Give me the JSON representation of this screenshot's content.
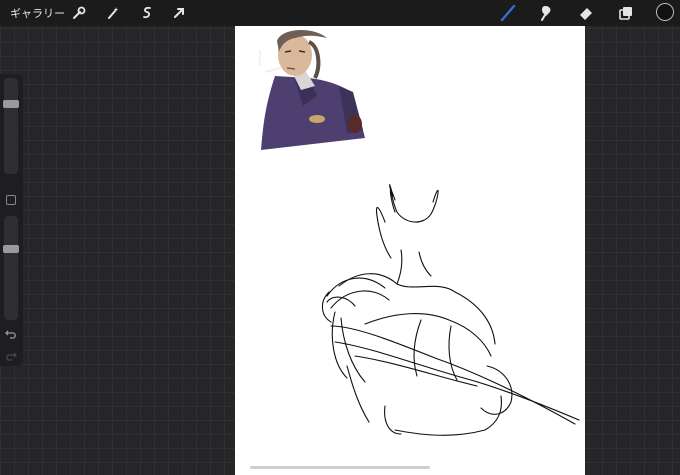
{
  "toolbar": {
    "gallery_label": "ギャラリー",
    "left_tools": [
      "wrench-icon",
      "magic-wand-icon",
      "selection-icon",
      "transform-arrow-icon"
    ],
    "right_tools": [
      "brush-icon",
      "smudge-icon",
      "eraser-icon",
      "layers-icon"
    ],
    "active_tool": "brush-icon",
    "active_color": "#2f6fd6",
    "current_color": "#111111"
  },
  "sidebar": {
    "size_slider_level": 0.75,
    "opacity_slider_level": 0.7,
    "items": [
      "size-slider",
      "modify-square",
      "opacity-slider",
      "undo-icon",
      "redo-icon"
    ]
  }
}
